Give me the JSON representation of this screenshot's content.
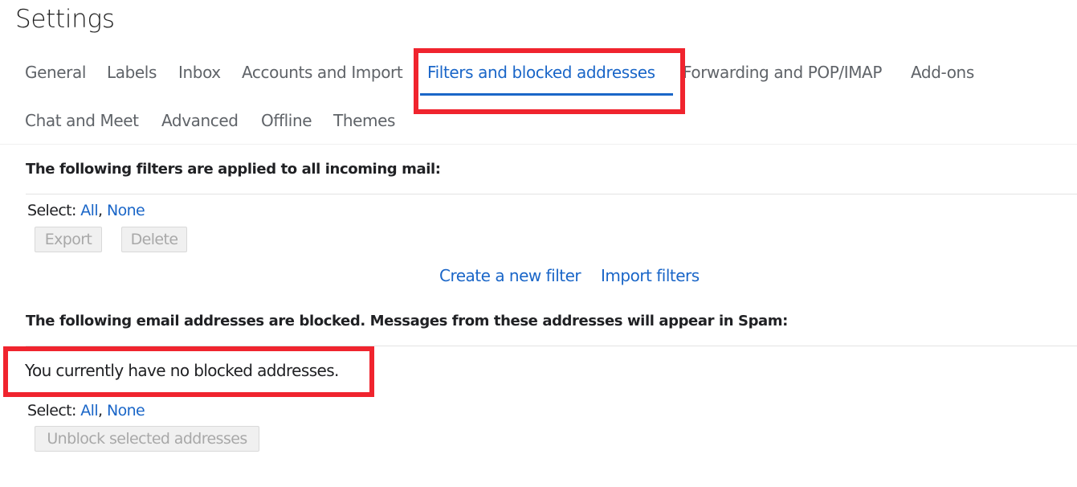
{
  "page": {
    "title": "Settings"
  },
  "tabs": [
    {
      "label": "General",
      "active": false
    },
    {
      "label": "Labels",
      "active": false
    },
    {
      "label": "Inbox",
      "active": false
    },
    {
      "label": "Accounts and Import",
      "active": false
    },
    {
      "label": "Filters and blocked addresses",
      "active": true
    },
    {
      "label": "Forwarding and POP/IMAP",
      "active": false
    },
    {
      "label": "Add-ons",
      "active": false
    },
    {
      "label": "Chat and Meet",
      "active": false
    },
    {
      "label": "Advanced",
      "active": false
    },
    {
      "label": "Offline",
      "active": false
    },
    {
      "label": "Themes",
      "active": false
    }
  ],
  "filters": {
    "heading": "The following filters are applied to all incoming mail:",
    "select_label": "Select:",
    "select_all": "All",
    "separator": ",",
    "select_none": "None",
    "export_button": "Export",
    "delete_button": "Delete",
    "create_filter_link": "Create a new filter",
    "import_filters_link": "Import filters"
  },
  "blocked": {
    "heading": "The following email addresses are blocked. Messages from these addresses will appear in Spam:",
    "empty_message": "You currently have no blocked addresses.",
    "select_label": "Select:",
    "select_all": "All",
    "separator": ",",
    "select_none": "None",
    "unblock_button": "Unblock selected addresses"
  },
  "colors": {
    "accent": "#1a66c8",
    "highlight_box": "#f0242e",
    "disabled_text": "#a8a8a8"
  }
}
